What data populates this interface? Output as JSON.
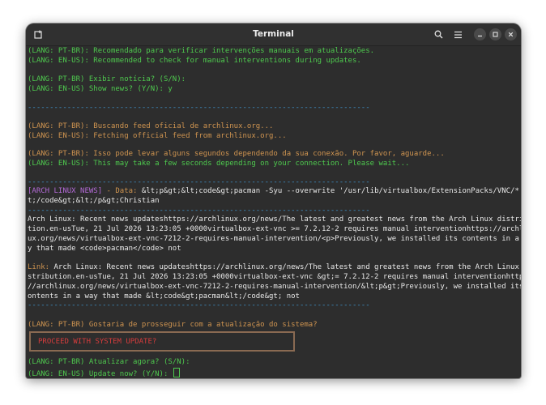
{
  "window": {
    "title": "Terminal"
  },
  "icons": {
    "new_tab": "new-tab-icon",
    "search": "search-icon",
    "menu": "hamburger-menu-icon",
    "minimize": "minimize-icon",
    "maximize": "maximize-icon",
    "close": "close-icon"
  },
  "colors": {
    "green": "#4ec94e",
    "orange": "#cf9450",
    "separator": "#3f93cc",
    "news_tag": "#b36ad6",
    "alert_red": "#d63c3c",
    "background": "#2d2d2d"
  },
  "terminal": {
    "l1": "(LANG: PT-BR): Recomendado para verificar intervenções manuais em atualizações.",
    "l2": "(LANG: EN-US): Recommended to check for manual interventions during updates.",
    "l3": "(LANG: PT-BR) Exibir notícia? (S/N):",
    "l4": "(LANG: EN-US) Show news? (Y/N): y",
    "sep": "------------------------------------------------------------------------------",
    "l5": "(LANG: PT-BR): Buscando feed oficial de archlinux.org...",
    "l6": "(LANG: EN-US): Fetching official feed from archlinux.org...",
    "l7": "(LANG: PT-BR): Isso pode levar alguns segundos dependendo da sua conexão. Por favor, aguarde...",
    "l8": "(LANG: EN-US): This may take a few seconds depending on your connection. Please wait...",
    "news_tag": "[ARCH LINUX NEWS]",
    "news_data_label": " - Data: ",
    "news_data_rest": "&lt;p&gt;&lt;code&gt;pacman -Syu --overwrite '/usr/lib/virtualbox/ExtensionPacks/VNC/*'&l",
    "news_data_2": "t;/code&gt;&lt;/p&gt;Christian",
    "body1": "Arch Linux: Recent news updateshttps://archlinux.org/news/The latest and greatest news from the Arch Linux distribu",
    "body2": "tion.en-usTue, 21 Jul 2026 13:23:05 +0000virtualbox-ext-vnc >= 7.2.12-2 requires manual interventionhttps://archlin",
    "body3": "ux.org/news/virtualbox-ext-vnc-7212-2-requires-manual-intervention/<p>Previously, we installed its contents in a wa",
    "body4": "y that made <code>pacman</code> not",
    "link_label": "Link:",
    "link1_rest": " Arch Linux: Recent news updateshttps://archlinux.org/news/The latest and greatest news from the Arch Linux di",
    "link2": "stribution.en-usTue, 21 Jul 2026 13:23:05 +0000virtualbox-ext-vnc &gt;= 7.2.12-2 requires manual interventionhttps:",
    "link3": "//archlinux.org/news/virtualbox-ext-vnc-7212-2-requires-manual-intervention/&lt;p&gt;Previously, we installed its c",
    "link4": "ontents in a way that made &lt;code&gt;pacman&lt;/code&gt; not",
    "l9": "(LANG: PT-BR) Gostaria de prosseguir com a atualização do sistema?",
    "box": "PROCEED WITH SYSTEM UPDATE?",
    "l10": "(LANG: PT-BR) Atualizar agora? (S/N):",
    "l11": "(LANG: EN-US) Update now? (Y/N): "
  }
}
